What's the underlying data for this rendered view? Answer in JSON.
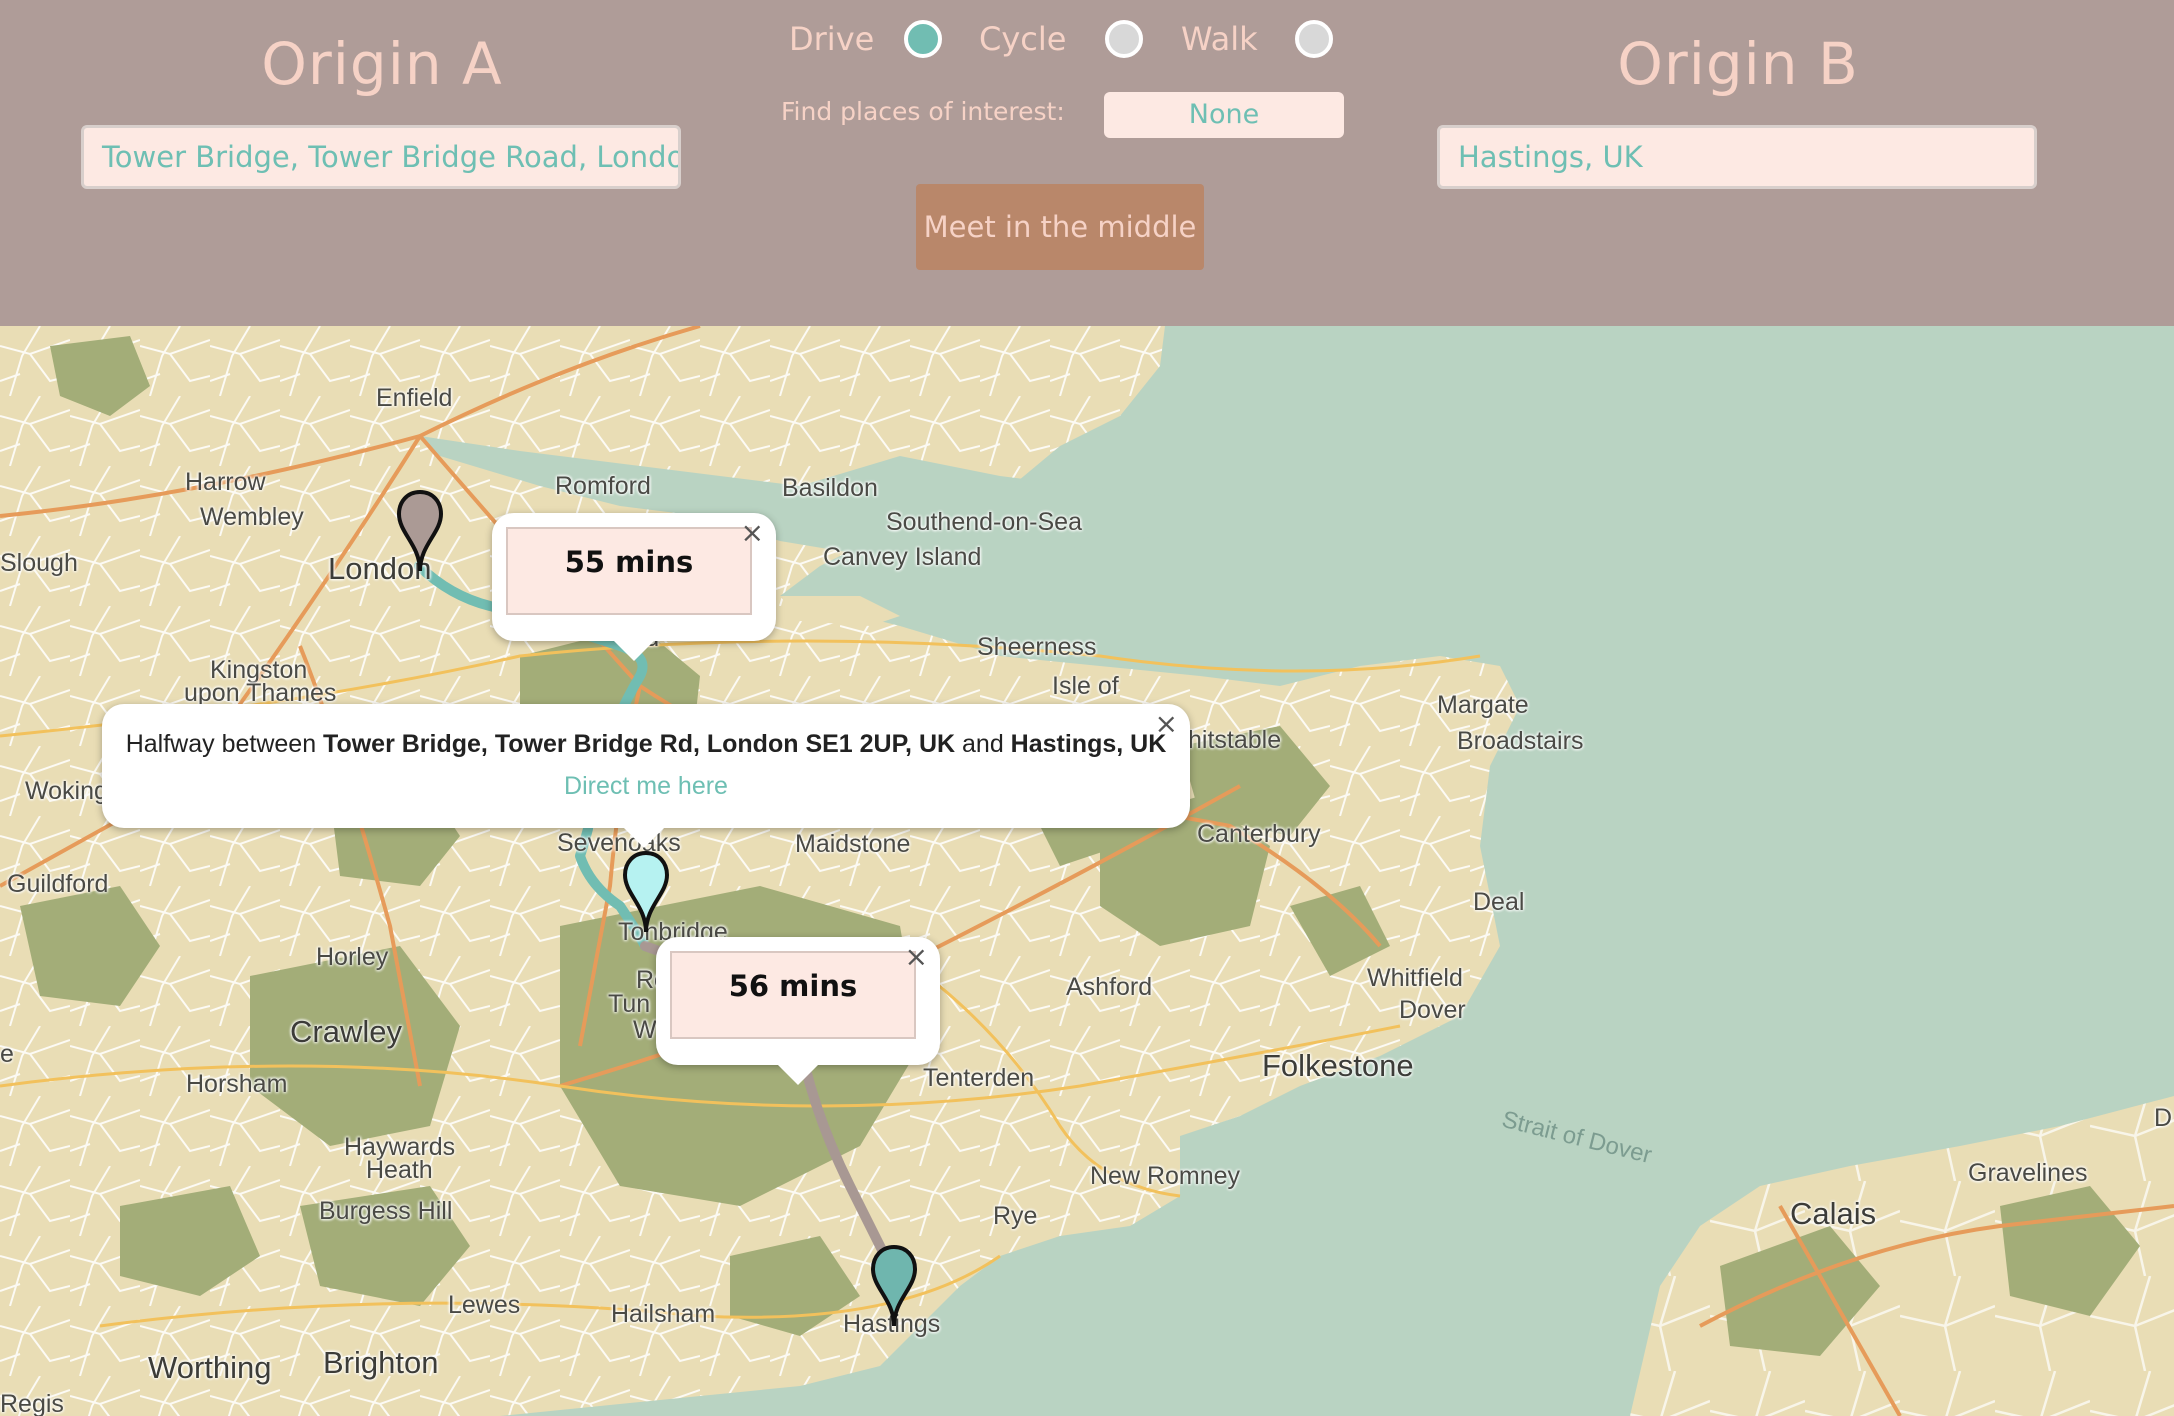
{
  "header": {
    "origin_a": {
      "title": "Origin A",
      "value": "Tower Bridge, Tower Bridge Road, London, U"
    },
    "origin_b": {
      "title": "Origin B",
      "value": "Hastings, UK"
    },
    "modes": [
      {
        "label": "Drive",
        "selected": true
      },
      {
        "label": "Cycle",
        "selected": false
      },
      {
        "label": "Walk",
        "selected": false
      }
    ],
    "poi_label": "Find places of interest:",
    "poi_value": "None",
    "meet_button": "Meet in the middle"
  },
  "colors": {
    "header_bg": "#af9c98",
    "accent": "#71bdb2",
    "button": "#b9876a",
    "sea": "#b9d3c2",
    "land": "#e9ddb5",
    "forest": "#a3ad78"
  },
  "map": {
    "places": [
      "Enfield",
      "Harrow",
      "Wembley",
      "Romford",
      "Basildon",
      "Southend-on-Sea",
      "Canvey Island",
      "Slough",
      "London",
      "Kingston",
      "upon Thames",
      "Sheerness",
      "Isle of",
      "Margate",
      "Broadstairs",
      "hitstable",
      "Woking",
      "Guildford",
      "Sevenoaks",
      "Maidstone",
      "Canterbury",
      "Tonbridge",
      "Horley",
      "Deal",
      "Ashford",
      "Whitfield",
      "Dover",
      "Crawley",
      "Tenterden",
      "Folkestone",
      "Horsham",
      "Haywards",
      "Heath",
      "New Romney",
      "Burgess Hill",
      "Rye",
      "Calais",
      "Gravelines",
      "Lewes",
      "Hailsham",
      "Hastings",
      "Worthing",
      "Brighton",
      "Regis",
      "Strait of Dover",
      "D",
      "e",
      "ord",
      "Ro",
      "Tun",
      "W"
    ],
    "pins": [
      {
        "name": "origin-a-pin",
        "color": "#ab9a95"
      },
      {
        "name": "midpoint-pin",
        "color": "#b6f2f1"
      },
      {
        "name": "origin-b-pin",
        "color": "#6fb6ae"
      }
    ],
    "popup_a_time": "55 mins",
    "popup_b_time": "56 mins",
    "close_symbol": "×",
    "halfway": {
      "prefix": "Halfway between ",
      "origin_a": "Tower Bridge, Tower Bridge Rd, London SE1 2UP, UK",
      "joiner": " and ",
      "origin_b": "Hastings, UK",
      "link": "Direct me here"
    }
  }
}
